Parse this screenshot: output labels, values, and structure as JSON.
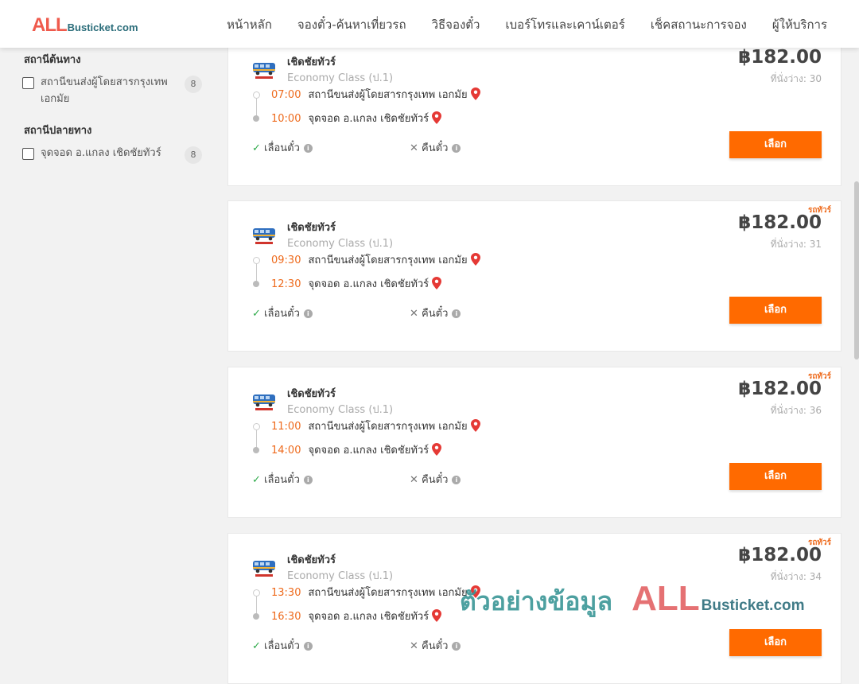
{
  "header": {
    "logo_all": "ALL",
    "logo_rest": "Busticket.com",
    "nav": [
      "หน้าหลัก",
      "จองตั๋ว-ค้นหาเที่ยวรถ",
      "วิธีจองตั๋ว",
      "เบอร์โทรและเคาน์เตอร์",
      "เช็คสถานะการจอง",
      "ผู้ให้บริการ"
    ]
  },
  "sidebar": {
    "origin_title": "สถานีต้นทาง",
    "origin_label": "สถานีขนส่งผู้โดยสารกรุงเทพ เอกมัย",
    "origin_count": "8",
    "dest_title": "สถานีปลายทาง",
    "dest_label": "จุดจอด อ.แกลง เชิดชัยทัวร์",
    "dest_count": "8"
  },
  "trips": [
    {
      "operator": "เชิดชัยทัวร์",
      "class": "Economy Class (ป.1)",
      "price": "฿182.00",
      "seats": "ที่นั่งว่าง: 30",
      "depart_time": "07:00",
      "depart_station": "สถานีขนส่งผู้โดยสารกรุงเทพ เอกมัย",
      "arrive_time": "10:00",
      "arrive_station": "จุดจอด อ.แกลง เชิดชัยทัวร์",
      "promo": ""
    },
    {
      "operator": "เชิดชัยทัวร์",
      "class": "Economy Class (ป.1)",
      "price": "฿182.00",
      "seats": "ที่นั่งว่าง: 31",
      "depart_time": "09:30",
      "depart_station": "สถานีขนส่งผู้โดยสารกรุงเทพ เอกมัย",
      "arrive_time": "12:30",
      "arrive_station": "จุดจอด อ.แกลง เชิดชัยทัวร์",
      "promo": "รถทัวร์"
    },
    {
      "operator": "เชิดชัยทัวร์",
      "class": "Economy Class (ป.1)",
      "price": "฿182.00",
      "seats": "ที่นั่งว่าง: 36",
      "depart_time": "11:00",
      "depart_station": "สถานีขนส่งผู้โดยสารกรุงเทพ เอกมัย",
      "arrive_time": "14:00",
      "arrive_station": "จุดจอด อ.แกลง เชิดชัยทัวร์",
      "promo": "รถทัวร์"
    },
    {
      "operator": "เชิดชัยทัวร์",
      "class": "Economy Class (ป.1)",
      "price": "฿182.00",
      "seats": "ที่นั่งว่าง: 34",
      "depart_time": "13:30",
      "depart_station": "สถานีขนส่งผู้โดยสารกรุงเทพ เอกมัย",
      "arrive_time": "16:30",
      "arrive_station": "จุดจอด อ.แกลง เชิดชัยทัวร์",
      "promo": "รถทัวร์"
    }
  ],
  "policy": {
    "reschedule": "เลื่อนตั๋ว",
    "refund": "คืนตั๋ว",
    "select": "เลือก"
  },
  "watermark": {
    "text": "ตัวอย่างข้อมูล",
    "all": "ALL",
    "rest": "Busticket.com"
  },
  "colors": {
    "accent": "#ff6a00",
    "time": "#ee6a1c",
    "check": "#2eaa4a",
    "pin": "#e53935"
  },
  "icons": {
    "check": "check-icon",
    "cross": "cross-icon",
    "info": "info-icon",
    "pin": "map-pin-icon",
    "logo": "bus-logo-icon"
  }
}
